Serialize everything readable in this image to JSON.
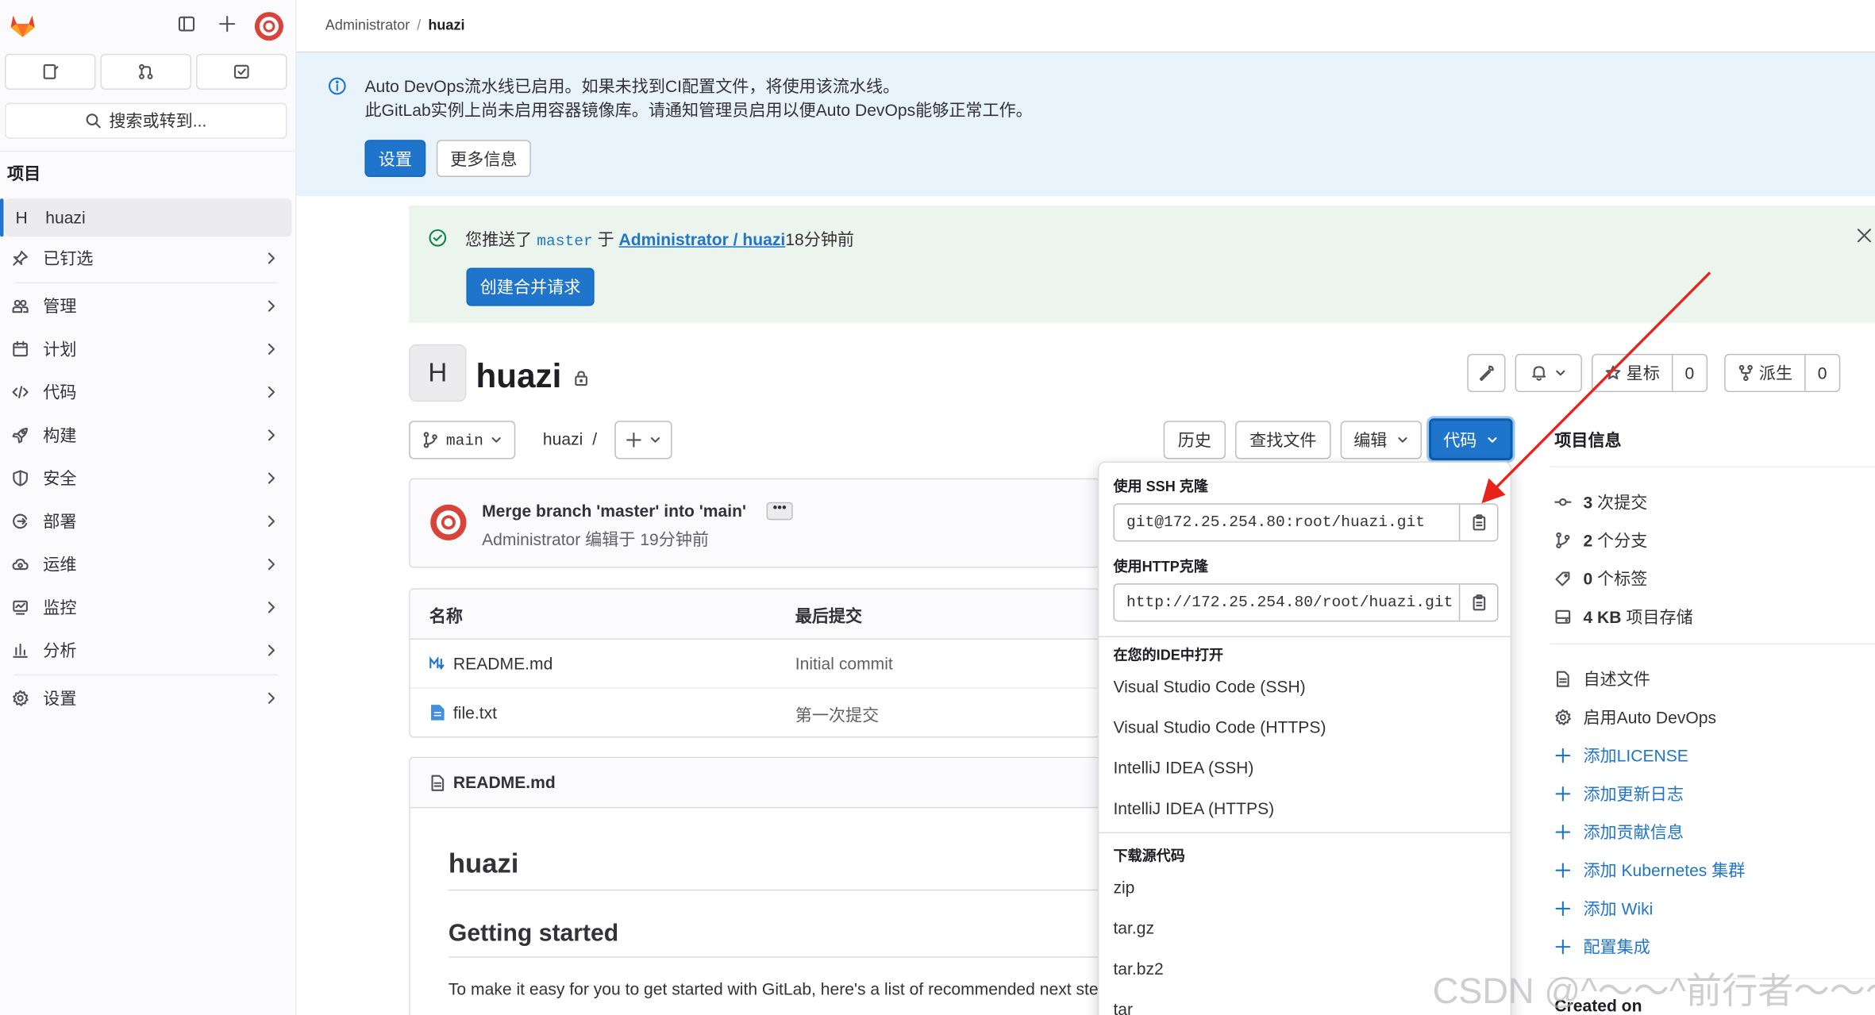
{
  "sidebar": {
    "search_label": "搜索或转到...",
    "section_title": "项目",
    "project": {
      "letter": "H",
      "name": "huazi"
    },
    "items": [
      {
        "label": "已钉选",
        "icon": "pin-icon"
      },
      {
        "label": "管理",
        "icon": "users-icon"
      },
      {
        "label": "计划",
        "icon": "calendar-icon"
      },
      {
        "label": "代码",
        "icon": "code-icon"
      },
      {
        "label": "构建",
        "icon": "rocket-icon"
      },
      {
        "label": "安全",
        "icon": "shield-icon"
      },
      {
        "label": "部署",
        "icon": "deploy-icon"
      },
      {
        "label": "运维",
        "icon": "cloud-gear-icon"
      },
      {
        "label": "监控",
        "icon": "monitor-icon"
      },
      {
        "label": "分析",
        "icon": "chart-icon"
      },
      {
        "label": "设置",
        "icon": "gear-icon"
      }
    ]
  },
  "breadcrumb": {
    "parent": "Administrator",
    "current": "huazi"
  },
  "info_alert": {
    "line1": "Auto DevOps流水线已启用。如果未找到CI配置文件，将使用该流水线。",
    "line2": "此GitLab实例上尚未启用容器镜像库。请通知管理员启用以便Auto DevOps能够正常工作。",
    "primary_button": "设置",
    "secondary_button": "更多信息"
  },
  "push_alert": {
    "prefix": "您推送了",
    "branch": "master",
    "middle": "于",
    "project_link": "Administrator / huazi",
    "time": "18分钟前",
    "button": "创建合并请求"
  },
  "project": {
    "letter": "H",
    "name": "huazi",
    "star_label": "星标",
    "star_count": "0",
    "fork_label": "派生",
    "fork_count": "0"
  },
  "repo_nav": {
    "branch": "main",
    "path": "huazi",
    "path_sep": "/",
    "history": "历史",
    "find_file": "查找文件",
    "edit": "编辑",
    "code": "代码"
  },
  "last_commit": {
    "title": "Merge branch 'master' into 'main'",
    "author": "Administrator",
    "action": "编辑于 19分钟前"
  },
  "files": {
    "col_name": "名称",
    "col_commit": "最后提交",
    "rows": [
      {
        "name": "README.md",
        "commit": "Initial commit",
        "icon": "markdown-icon"
      },
      {
        "name": "file.txt",
        "commit": "第一次提交",
        "icon": "file-icon"
      }
    ]
  },
  "readme": {
    "filename": "README.md",
    "h1": "huazi",
    "h2": "Getting started",
    "p": "To make it easy for you to get started with GitLab, here's a list of recommended next steps."
  },
  "code_dropdown": {
    "ssh_label": "使用 SSH 克隆",
    "ssh_url": "git@172.25.254.80:root/huazi.git",
    "http_label": "使用HTTP克隆",
    "http_url": "http://172.25.254.80/root/huazi.git",
    "ide_label": "在您的IDE中打开",
    "ide_items": [
      "Visual Studio Code (SSH)",
      "Visual Studio Code (HTTPS)",
      "IntelliJ IDEA (SSH)",
      "IntelliJ IDEA (HTTPS)"
    ],
    "download_label": "下载源代码",
    "download_items": [
      "zip",
      "tar.gz",
      "tar.bz2",
      "tar"
    ]
  },
  "project_info": {
    "title": "项目信息",
    "stats": [
      {
        "count": "3",
        "label": "次提交",
        "icon": "commit-icon"
      },
      {
        "count": "2",
        "label": "个分支",
        "icon": "branch-icon"
      },
      {
        "count": "0",
        "label": "个标签",
        "icon": "tag-icon"
      },
      {
        "count": "4 KB",
        "label": "项目存储",
        "icon": "storage-icon"
      }
    ],
    "links": [
      {
        "label": "自述文件",
        "icon": "doc-icon",
        "blue": false
      },
      {
        "label": "启用Auto DevOps",
        "icon": "gear-icon",
        "blue": false
      },
      {
        "label": "添加LICENSE",
        "icon": "plus-icon",
        "blue": true
      },
      {
        "label": "添加更新日志",
        "icon": "plus-icon",
        "blue": true
      },
      {
        "label": "添加贡献信息",
        "icon": "plus-icon",
        "blue": true
      },
      {
        "label": "添加 Kubernetes 集群",
        "icon": "plus-icon",
        "blue": true
      },
      {
        "label": "添加 Wiki",
        "icon": "plus-icon",
        "blue": true
      },
      {
        "label": "配置集成",
        "icon": "plus-icon",
        "blue": true
      }
    ],
    "created_on": "Created on"
  },
  "watermark": "CSDN @^～～^前行者～～～",
  "colors": {
    "brand_blue": "#1f75cb",
    "info_bg": "#e9f3fc",
    "success_bg": "#ecf4ee",
    "annotation_red": "#e8231b"
  }
}
